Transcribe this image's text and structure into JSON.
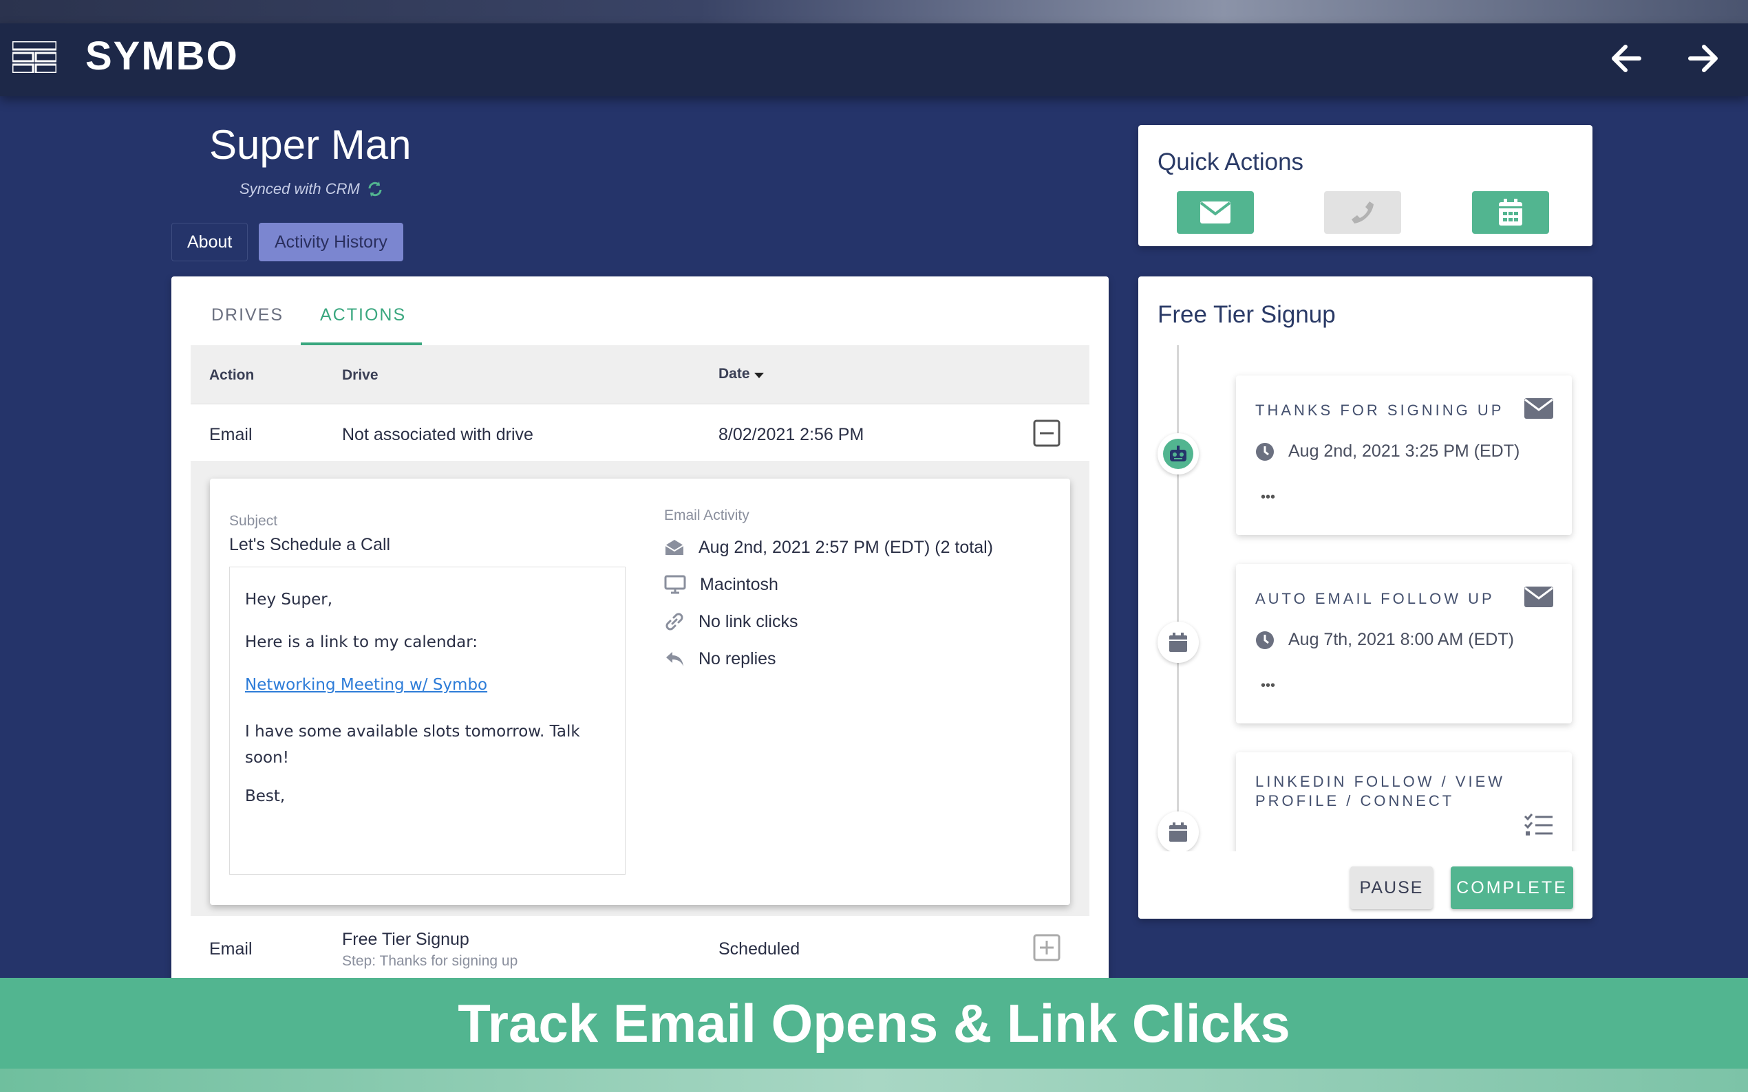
{
  "app": {
    "brand": "SYMBO"
  },
  "contact": {
    "name": "Super Man",
    "sync_status": "Synced with CRM"
  },
  "profile_tabs": [
    {
      "label": "About"
    },
    {
      "label": "Activity History",
      "active": true
    }
  ],
  "inner_tabs": [
    {
      "label": "DRIVES"
    },
    {
      "label": "ACTIONS",
      "active": true
    }
  ],
  "table": {
    "headers": [
      "Action",
      "Drive",
      "Date"
    ],
    "rows": [
      {
        "action": "Email",
        "drive": "Not associated with drive",
        "date": "8/02/2021 2:56 PM",
        "expanded": true
      },
      {
        "action": "Email",
        "drive": "Free Tier Signup",
        "step": "Step: Thanks for signing up",
        "date": "Scheduled",
        "expanded": false
      }
    ]
  },
  "email_detail": {
    "subject_label": "Subject",
    "subject": "Let's Schedule a Call",
    "body": {
      "greeting": "Hey Super,",
      "line1": "Here is a link to my calendar:",
      "link": "Networking Meeting w/ Symbo",
      "line2": "I have some available slots tomorrow. Talk soon!",
      "signoff": "Best,"
    },
    "activity_label": "Email Activity",
    "activity": [
      {
        "icon": "envelope-open-icon",
        "text": "Aug 2nd, 2021 2:57 PM (EDT) (2 total)"
      },
      {
        "icon": "desktop-icon",
        "text": "Macintosh"
      },
      {
        "icon": "link-icon",
        "text": "No link clicks"
      },
      {
        "icon": "reply-icon",
        "text": "No replies"
      }
    ]
  },
  "quick_actions": {
    "title": "Quick Actions",
    "buttons": [
      {
        "icon": "envelope-icon",
        "enabled": true
      },
      {
        "icon": "phone-icon",
        "enabled": false
      },
      {
        "icon": "calendar-icon",
        "enabled": true
      }
    ]
  },
  "drive_panel": {
    "title": "Free Tier Signup",
    "steps": [
      {
        "title": "THANKS FOR SIGNING UP",
        "date": "Aug 2nd, 2021 3:25 PM (EDT)",
        "more": "•••",
        "node_icon": "robot-icon",
        "type_icon": "envelope-icon"
      },
      {
        "title": "AUTO EMAIL FOLLOW UP",
        "date": "Aug 7th, 2021 8:00 AM (EDT)",
        "more": "•••",
        "node_icon": "calendar-icon",
        "type_icon": "envelope-icon"
      },
      {
        "title_line1": "LINKEDIN FOLLOW / VIEW",
        "title_line2": "PROFILE / CONNECT",
        "node_icon": "calendar-icon",
        "type_icon": "checklist-icon"
      }
    ],
    "pause_label": "PAUSE",
    "complete_label": "COMPLETE"
  },
  "banner": {
    "text": "Track Email Opens & Link Clicks"
  },
  "colors": {
    "navy": "#25346a",
    "navbar": "#1d2848",
    "accent_green": "#52b590",
    "tab_active": "#7b86d0"
  }
}
